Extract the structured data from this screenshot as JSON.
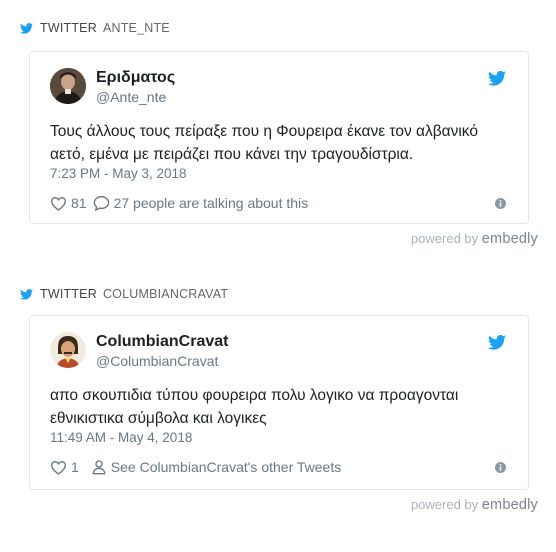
{
  "colors": {
    "twitter_blue": "#1da1f2",
    "text": "#1c2022",
    "muted": "#697882",
    "border": "#e1e8ed"
  },
  "embeds": [
    {
      "source": {
        "name": "TWITTER",
        "handle": "ANTE_NTE",
        "icon": "twitter-bird-icon"
      },
      "author": {
        "name": "Εριδματος",
        "handle": "@Ante_nte"
      },
      "text": "Τους άλλους τους πείραξε που η Φουρειρα έκανε τον αλβανικό αετό, εμένα με πειράζει που κάνει την τραγουδίστρια.",
      "time": "7:23 PM - May 3, 2018",
      "likes": "81",
      "secondary_action": {
        "icon": "speech-bubble-icon",
        "label": "27 people are talking about this"
      },
      "powered_by": {
        "prefix": "powered by",
        "brand": "embedly"
      }
    },
    {
      "source": {
        "name": "TWITTER",
        "handle": "COLUMBIANCRAVAT",
        "icon": "twitter-bird-icon"
      },
      "author": {
        "name": "ColumbianCravat",
        "handle": "@ColumbianCravat"
      },
      "text": "απο σκουπιδια τύπου φουρειρα πολυ λογικο να προαγονται εθνικιστικα σύμβολα και λογικες",
      "time": "11:49 AM - May 4, 2018",
      "likes": "1",
      "secondary_action": {
        "icon": "person-icon",
        "label": "See ColumbianCravat's other Tweets"
      },
      "powered_by": {
        "prefix": "powered by",
        "brand": "embedly"
      }
    }
  ]
}
